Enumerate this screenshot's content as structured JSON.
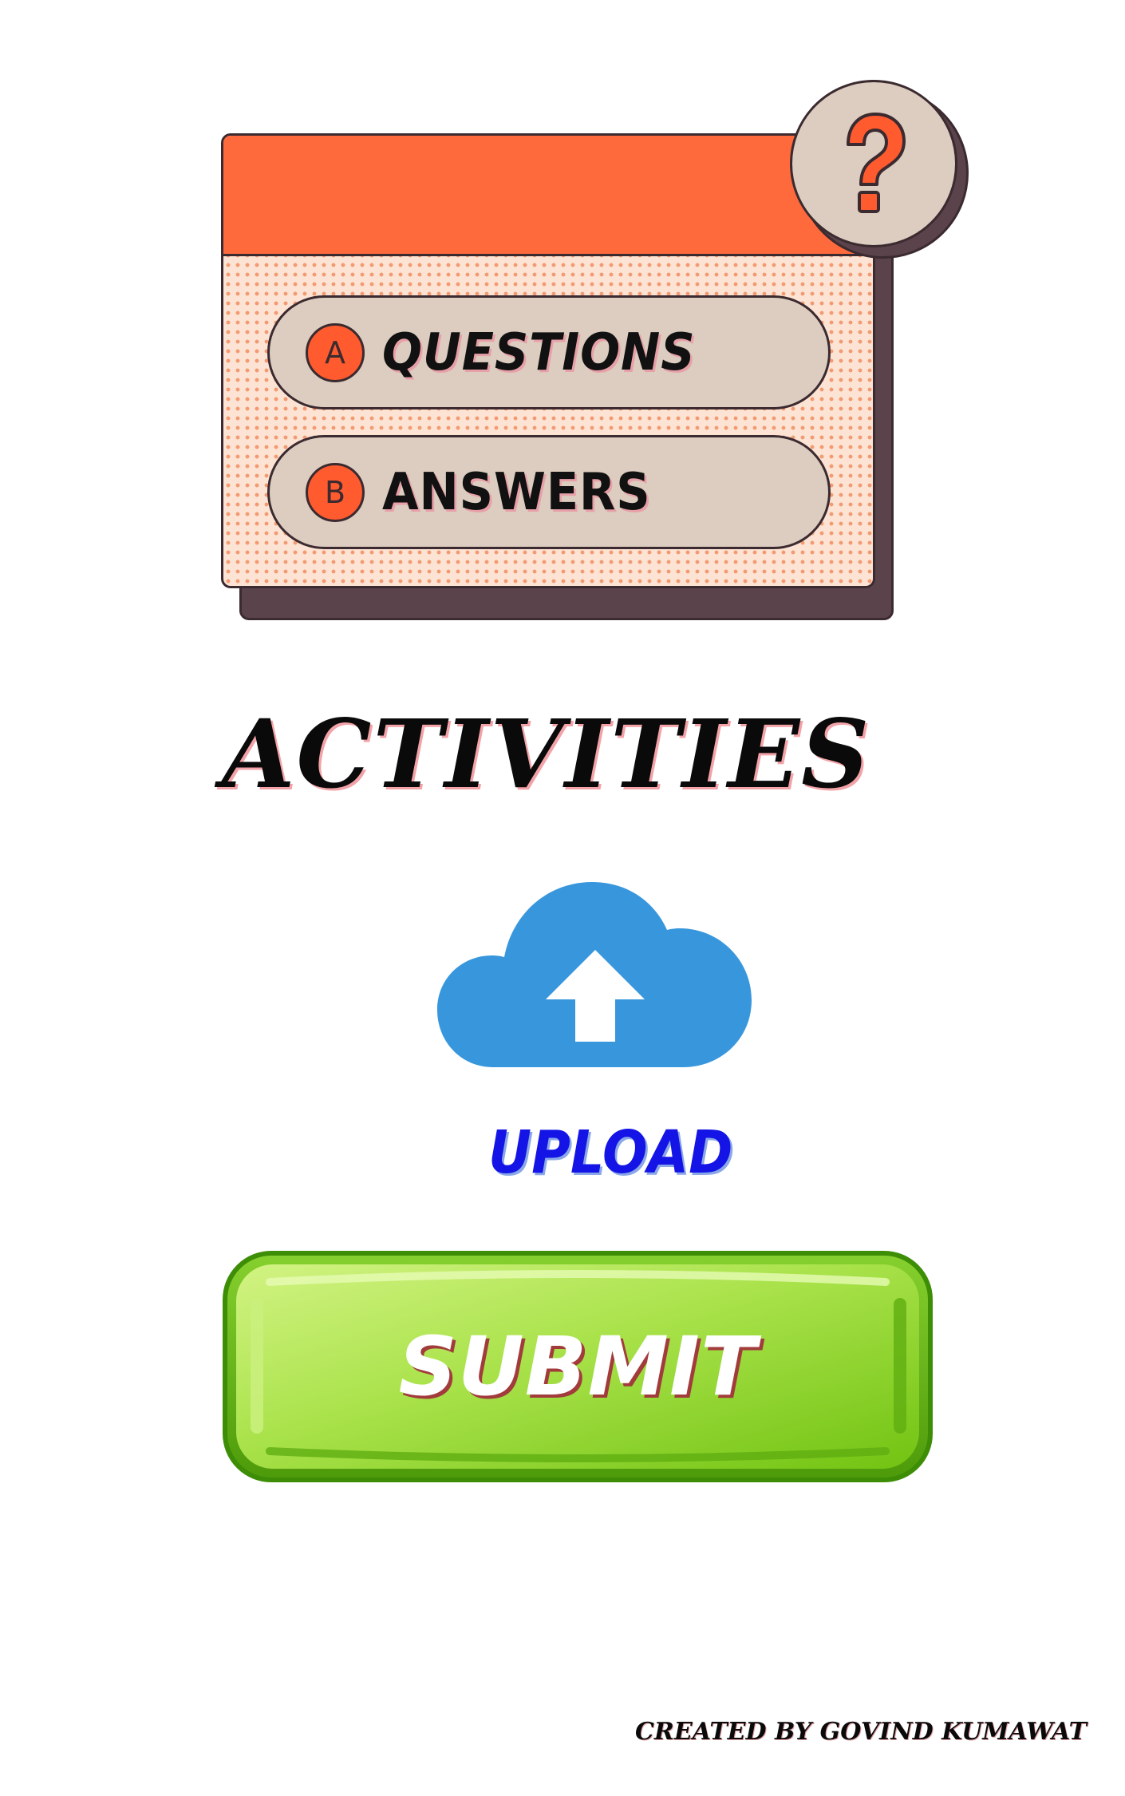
{
  "quiz_card": {
    "option_a": {
      "letter": "A",
      "label": "QUESTIONS"
    },
    "option_b": {
      "letter": "B",
      "label": "ANSWERS"
    },
    "badge_icon": "question-mark-icon"
  },
  "headline": "ACTIVITIES",
  "upload": {
    "icon": "cloud-upload-icon",
    "label": "UPLOAD"
  },
  "submit": {
    "label": "SUBMIT"
  },
  "credit": "CREATED BY GOVIND KUMAWAT",
  "colors": {
    "card_header": "#ff6a3d",
    "card_dots_bg": "#fce3d3",
    "option_pill": "#dccdc0",
    "outline": "#3b2a2f",
    "cloud": "#3897dc",
    "upload_text": "#1414e6",
    "submit_green": "#8fd32a"
  }
}
